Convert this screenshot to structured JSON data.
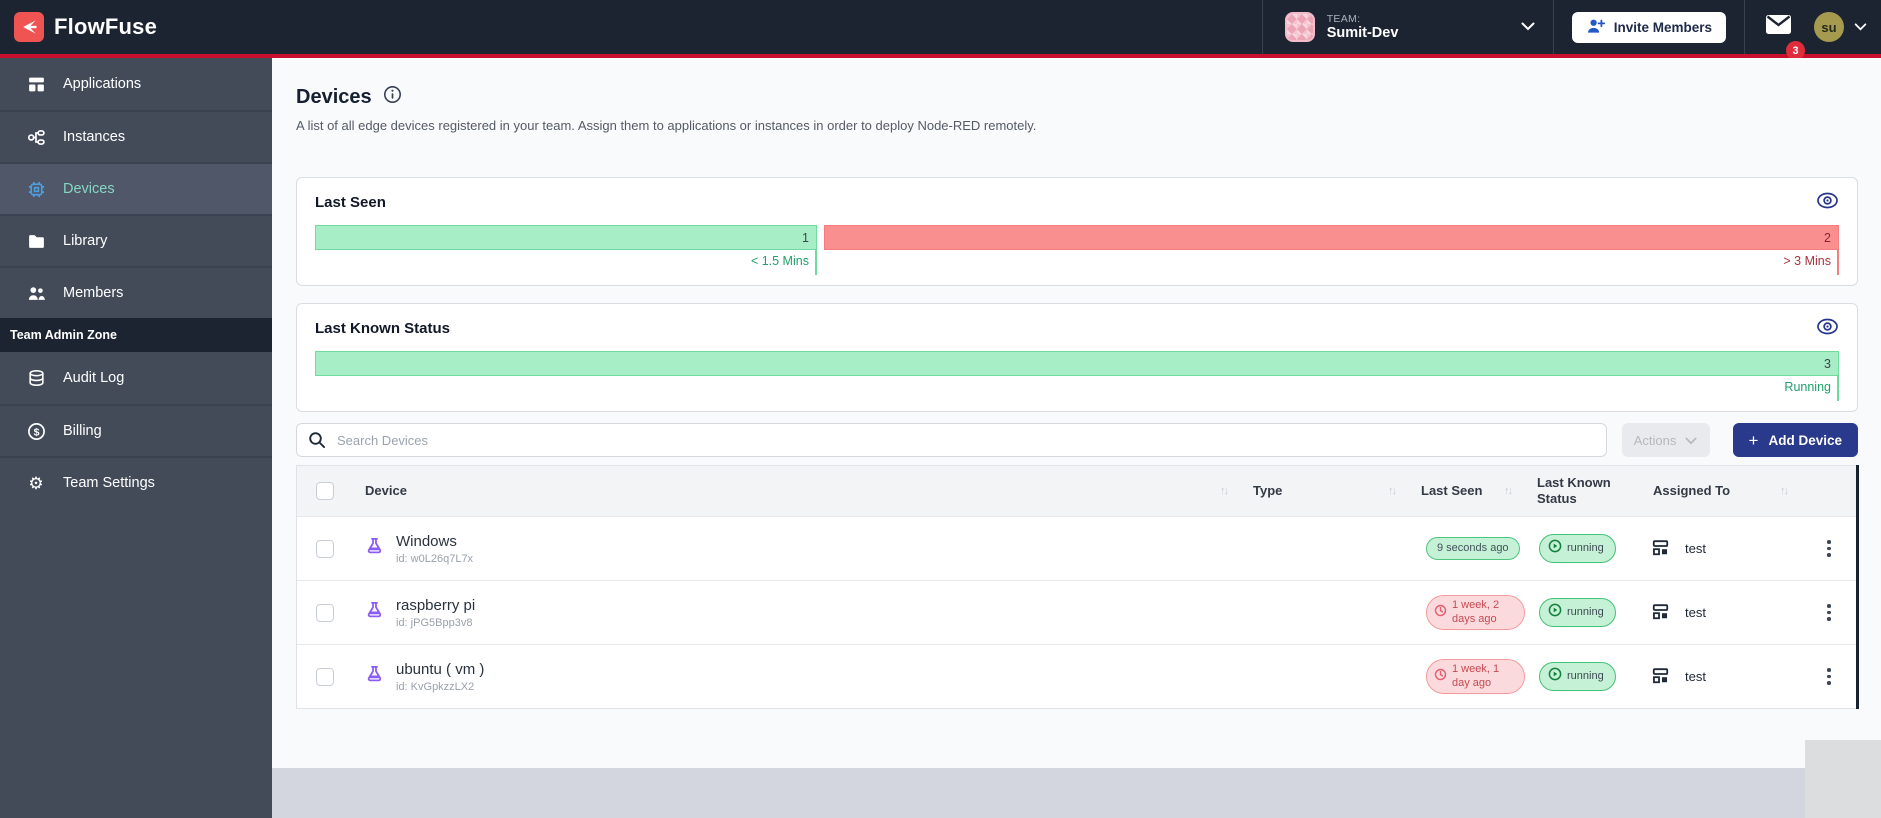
{
  "navbar": {
    "logo_text": "FlowFuse",
    "team_label": "TEAM:",
    "team_name": "Sumit-Dev",
    "invite_button": "Invite Members",
    "mail_badge": "3",
    "user_initials": "su"
  },
  "sidebar": {
    "items": [
      {
        "label": "Applications"
      },
      {
        "label": "Instances"
      },
      {
        "label": "Devices"
      },
      {
        "label": "Library"
      },
      {
        "label": "Members"
      }
    ],
    "admin_zone_label": "Team Admin Zone",
    "admin_items": [
      {
        "label": "Audit Log"
      },
      {
        "label": "Billing"
      },
      {
        "label": "Team Settings"
      }
    ]
  },
  "page": {
    "title": "Devices",
    "description": "A list of all edge devices registered in your team. Assign them to applications or instances in order to deploy Node-RED remotely."
  },
  "cards": {
    "last_seen": {
      "title": "Last Seen",
      "segments": [
        {
          "value": "1",
          "label": "< 1.5 Mins"
        },
        {
          "value": "2",
          "label": "> 3 Mins"
        }
      ]
    },
    "last_known_status": {
      "title": "Last Known Status",
      "segments": [
        {
          "value": "3",
          "label": "Running"
        }
      ]
    }
  },
  "chart_data": [
    {
      "type": "bar",
      "title": "Last Seen",
      "categories": [
        "< 1.5 Mins",
        "> 3 Mins"
      ],
      "values": [
        1,
        2
      ]
    },
    {
      "type": "bar",
      "title": "Last Known Status",
      "categories": [
        "Running"
      ],
      "values": [
        3
      ]
    }
  ],
  "toolbar": {
    "search_placeholder": "Search Devices",
    "actions_label": "Actions",
    "add_device_plus": "+",
    "add_device_label": "Add Device"
  },
  "table": {
    "headers": {
      "device": "Device",
      "type": "Type",
      "last_seen": "Last Seen",
      "last_known_status": "Last Known Status",
      "assigned_to": "Assigned To"
    },
    "rows": [
      {
        "name": "Windows",
        "id": "id: w0L26q7L7x",
        "last_seen": "9 seconds ago",
        "status": "running",
        "assigned_to": "test"
      },
      {
        "name": "raspberry pi",
        "id": "id: jPG5Bpp3v8",
        "last_seen": "1 week, 2 days ago",
        "status": "running",
        "assigned_to": "test"
      },
      {
        "name": "ubuntu ( vm )",
        "id": "id: KvGpkzzLX2",
        "last_seen": "1 week, 1 day ago",
        "status": "running",
        "assigned_to": "test"
      }
    ]
  },
  "colors": {
    "navbar": "#1c2432",
    "accent_line": "#c8102e",
    "brand_red": "#ef5352",
    "primary_button": "#29398c",
    "success_fill": "#a7edc5",
    "danger_fill": "#f98f8f",
    "active_nav_text": "#87d7c3"
  }
}
